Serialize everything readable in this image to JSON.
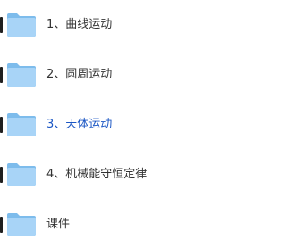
{
  "folder_list": {
    "items": [
      {
        "label": "1、曲线运动",
        "active": false
      },
      {
        "label": "2、圆周运动",
        "active": false
      },
      {
        "label": "3、天体运动",
        "active": true
      },
      {
        "label": "4、机械能守恒定律",
        "active": false
      },
      {
        "label": "课件",
        "active": false
      }
    ]
  },
  "icons": {
    "folder": "folder-icon"
  },
  "colors": {
    "text": "#333333",
    "active_text": "#1a56c4",
    "folder_body": "#a8d4f7",
    "folder_back": "#7dbcec",
    "edge_marker": "#1f1f1f"
  }
}
